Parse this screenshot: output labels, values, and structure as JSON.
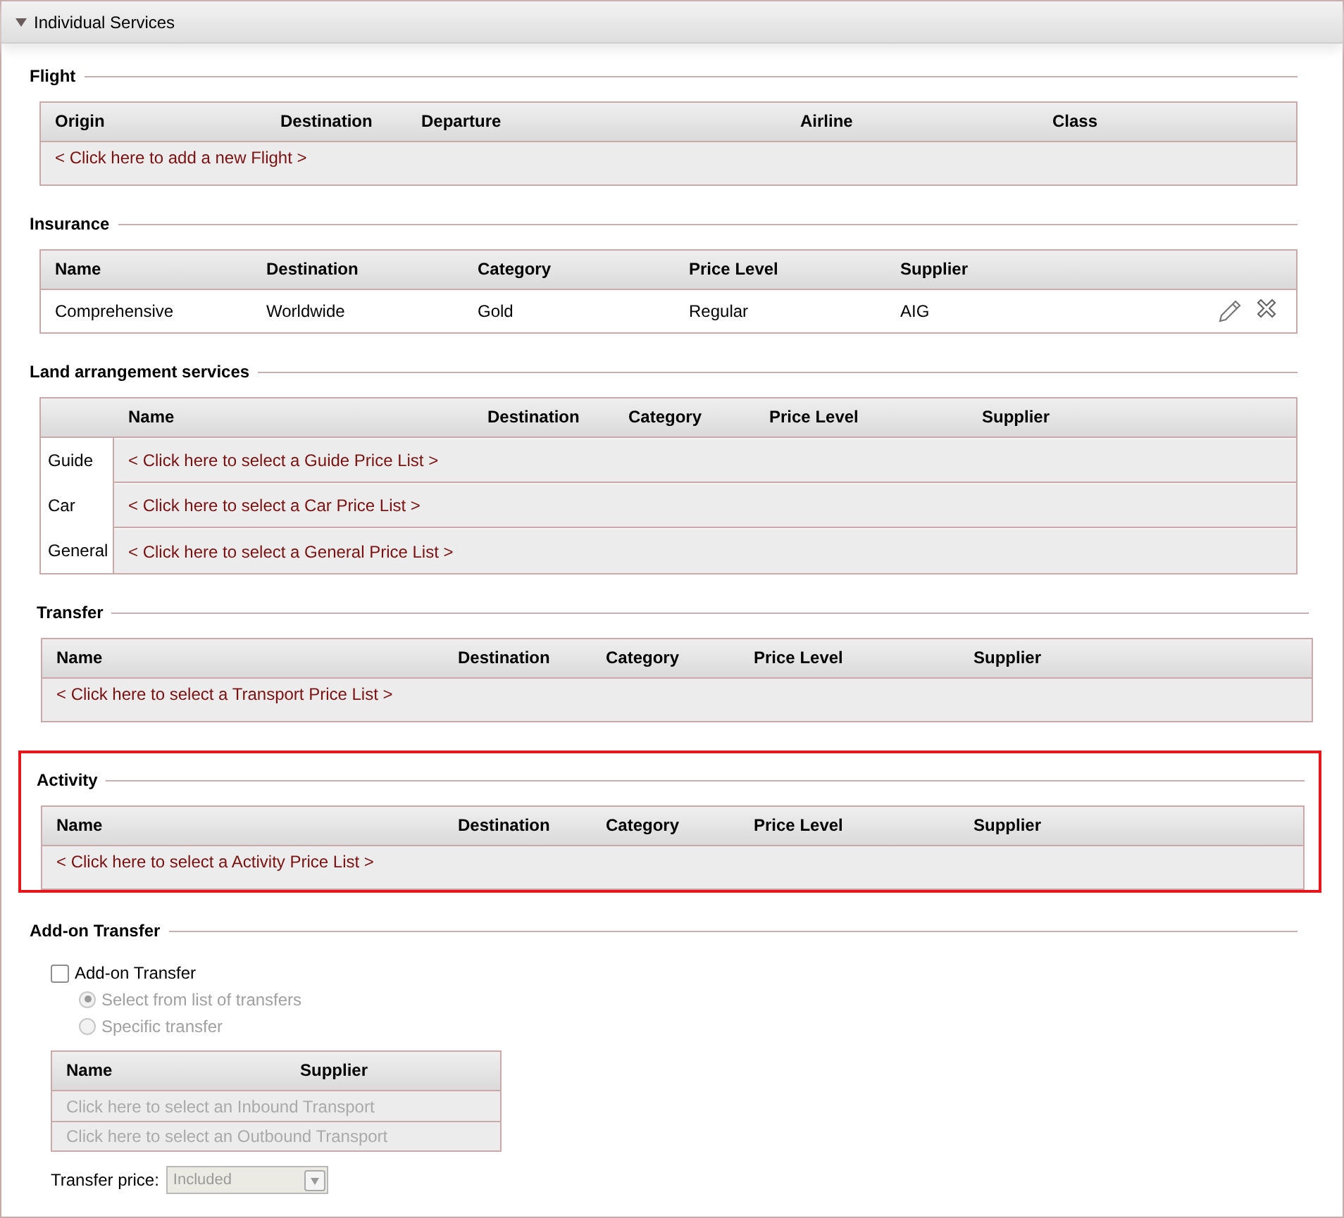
{
  "panel": {
    "title": "Individual Services",
    "expanded": true
  },
  "sections": [
    {
      "kind": "table",
      "title": "Flight",
      "highlighted": false,
      "columns": [
        "Origin",
        "Destination",
        "Departure",
        "Airline",
        "Class"
      ],
      "rows": [
        {
          "kind": "link",
          "cells": [
            "< Click here to add a new Flight >"
          ]
        }
      ]
    },
    {
      "kind": "table",
      "title": "Insurance",
      "highlighted": false,
      "columns": [
        "Name",
        "Destination",
        "Category",
        "Price Level",
        "Supplier"
      ],
      "rows": [
        {
          "kind": "data",
          "cells": [
            "Comprehensive",
            "Worldwide",
            "Gold",
            "Regular",
            "AIG"
          ]
        }
      ]
    },
    {
      "kind": "grouped",
      "title": "Land arrangement services",
      "highlighted": false,
      "columns": [
        "Name",
        "Destination",
        "Category",
        "Price Level",
        "Supplier"
      ],
      "rows": [
        {
          "label": "Guide",
          "link": "< Click here to select a Guide Price List >"
        },
        {
          "label": "Car",
          "link": "< Click here to select a Car Price List >"
        },
        {
          "label": "General",
          "link": "< Click here to select a General Price List >"
        }
      ]
    },
    {
      "kind": "table",
      "title": "Transfer",
      "highlighted": false,
      "columns": [
        "Name",
        "Destination",
        "Category",
        "Price Level",
        "Supplier"
      ],
      "rows": [
        {
          "kind": "link",
          "cells": [
            "< Click here to select a Transport Price List >"
          ]
        }
      ]
    },
    {
      "kind": "table",
      "title": "Activity",
      "highlighted": true,
      "columns": [
        "Name",
        "Destination",
        "Category",
        "Price Level",
        "Supplier"
      ],
      "rows": [
        {
          "kind": "link",
          "cells": [
            "< Click here to select a Activity Price List >"
          ]
        }
      ]
    },
    {
      "kind": "addon",
      "title": "Add-on Transfer",
      "highlighted": false,
      "checkbox": {
        "label": "Add-on Transfer",
        "checked": false
      },
      "options": [
        {
          "label": "Select from list of transfers",
          "selected": true,
          "disabled": true
        },
        {
          "label": "Specific transfer",
          "selected": false,
          "disabled": true
        }
      ],
      "columns": [
        "Name",
        "Supplier"
      ],
      "rows": [
        {
          "kind": "link",
          "disabled": true,
          "cells": [
            "Click here to select an Inbound Transport"
          ]
        },
        {
          "kind": "link",
          "disabled": true,
          "cells": [
            "Click here to select an Outbound Transport"
          ]
        }
      ],
      "price": {
        "label": "Transfer price:",
        "value": "Included",
        "disabled": true
      }
    }
  ]
}
